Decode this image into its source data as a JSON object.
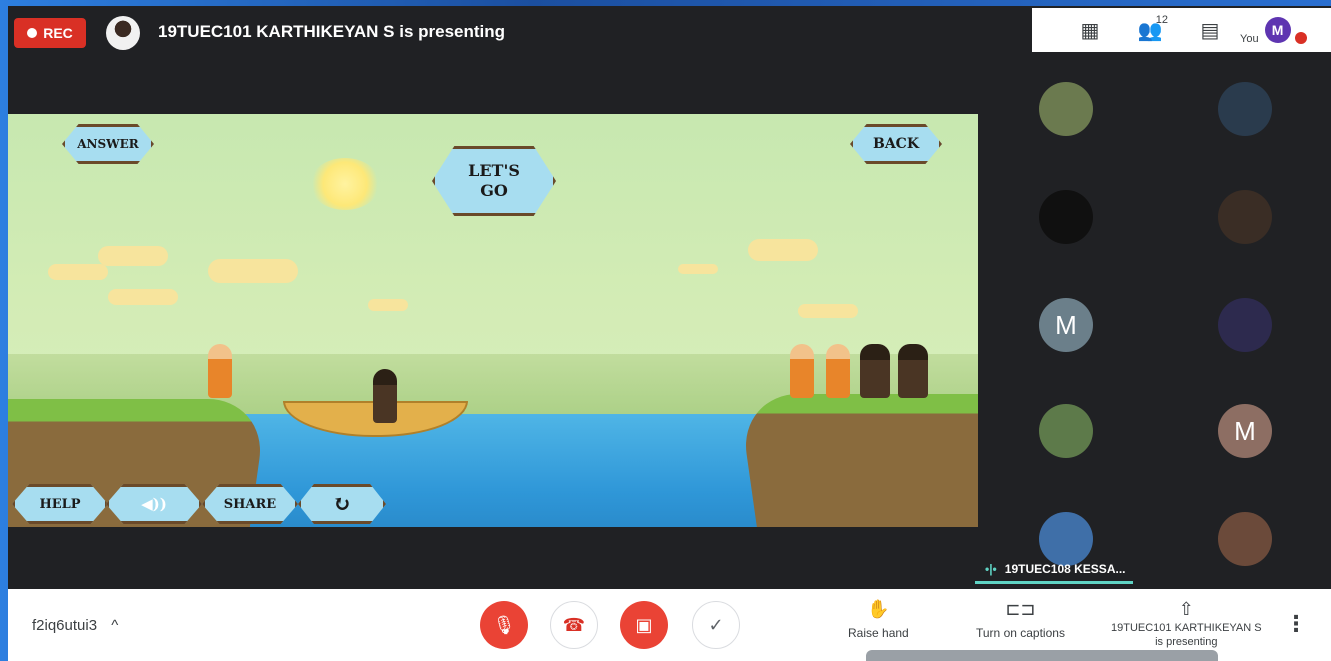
{
  "recording": {
    "label": "REC"
  },
  "presenter": {
    "banner": "19TUEC101 KARTHIKEYAN S is presenting"
  },
  "top_right": {
    "participants_count": "12",
    "you_label": "You",
    "you_initial": "M"
  },
  "game": {
    "answer_label": "ANSWER",
    "back_label": "BACK",
    "lets_go_line1": "LET'S",
    "lets_go_line2": "GO",
    "help_label": "HELP",
    "share_label": "SHARE",
    "sound_symbol": "◀))",
    "reload_symbol": "↻"
  },
  "tiles": [
    {
      "name": "participant-tile-1",
      "initial": "",
      "color": "#6b7a4f"
    },
    {
      "name": "participant-tile-2",
      "initial": "",
      "color": "#2a3b4d"
    },
    {
      "name": "participant-tile-3",
      "initial": "",
      "color": "#101010"
    },
    {
      "name": "participant-tile-4",
      "initial": "",
      "color": "#3a2d25"
    },
    {
      "name": "participant-tile-5",
      "initial": "M",
      "color": "#6b7f8a"
    },
    {
      "name": "participant-tile-6",
      "initial": "",
      "color": "#2d2a4e"
    },
    {
      "name": "participant-tile-7",
      "initial": "",
      "color": "#5d7a4a"
    },
    {
      "name": "participant-tile-8",
      "initial": "M",
      "color": "#8d6e63"
    },
    {
      "name": "participant-tile-9",
      "initial": "",
      "color": "#3f6fa8"
    },
    {
      "name": "participant-tile-10",
      "initial": "",
      "color": "#6b4a3a"
    }
  ],
  "speaking": {
    "label": "19TUEC108 KESSA..."
  },
  "bottom_bar": {
    "meeting_code": "f2iq6utui3",
    "chevron": "^",
    "raise_hand": "Raise hand",
    "captions": "Turn on captions",
    "presenting_line1": "19TUEC101 KARTHIKEYAN S",
    "presenting_line2": "is presenting",
    "more_symbol": "⋮"
  }
}
